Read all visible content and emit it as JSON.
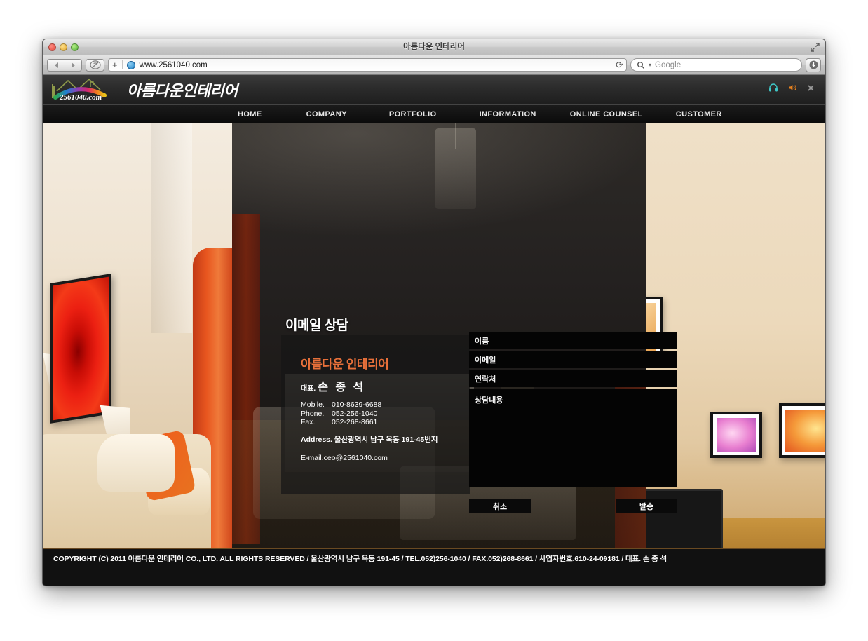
{
  "browser": {
    "window_title": "아름다운 인테리어",
    "url": "www.2561040.com",
    "search_placeholder": "Google",
    "new_tab_label": "+",
    "reload_label": "⟳",
    "icons": {
      "back": "back-arrow-icon",
      "forward": "forward-arrow-icon",
      "share": "share-icon",
      "globe": "globe-icon",
      "search": "search-icon",
      "download": "download-icon",
      "fullscreen": "fullscreen-icon"
    },
    "traffic_lights": [
      "close",
      "minimize",
      "zoom"
    ]
  },
  "site": {
    "logo_domain": "2561040.com",
    "brand": "아름다운인테리어",
    "header_icons": [
      "headphones-icon",
      "speaker-icon",
      "close-icon"
    ],
    "nav": [
      {
        "label": "HOME"
      },
      {
        "label": "COMPANY"
      },
      {
        "label": "PORTFOLIO"
      },
      {
        "label": "INFORMATION"
      },
      {
        "label": "ONLINE COUNSEL"
      },
      {
        "label": "CUSTOMER"
      }
    ],
    "page_title": "이메일 상담",
    "info": {
      "company": "아름다운 인테리어",
      "ceo_label": "대표.",
      "ceo_name": "손 종 석",
      "mobile_label": "Mobile.",
      "mobile": "010-8639-6688",
      "phone_label": "Phone.",
      "phone": "052-256-1040",
      "fax_label": "Fax.",
      "fax": "052-268-8661",
      "address": "Address. 울산광역시 남구 옥동 191-45번지",
      "email": "E-mail.ceo@2561040.com"
    },
    "form": {
      "name_label": "이름",
      "name_value": "",
      "email_label": "이메일",
      "email_value": "",
      "contact_label": "연락처",
      "contact_value": "",
      "message_label": "상담내용",
      "message_value": "",
      "cancel_button": "취소",
      "submit_button": "발송"
    },
    "footer": "COPYRIGHT (C) 2011 아름다운 인테리어 CO., LTD. ALL RIGHTS RESERVED / 울산광역시 남구 옥동 191-45 / TEL.052)256-1040 / FAX.052)268-8661 / 사업자번호.610-24-09181 / 대표. 손 종 석"
  },
  "colors": {
    "accent_orange": "#e8703a",
    "header_dark": "#2b2b2b",
    "nav_dark": "#0b0b0b",
    "footer_dark": "#111111",
    "field_black": "#040404"
  }
}
